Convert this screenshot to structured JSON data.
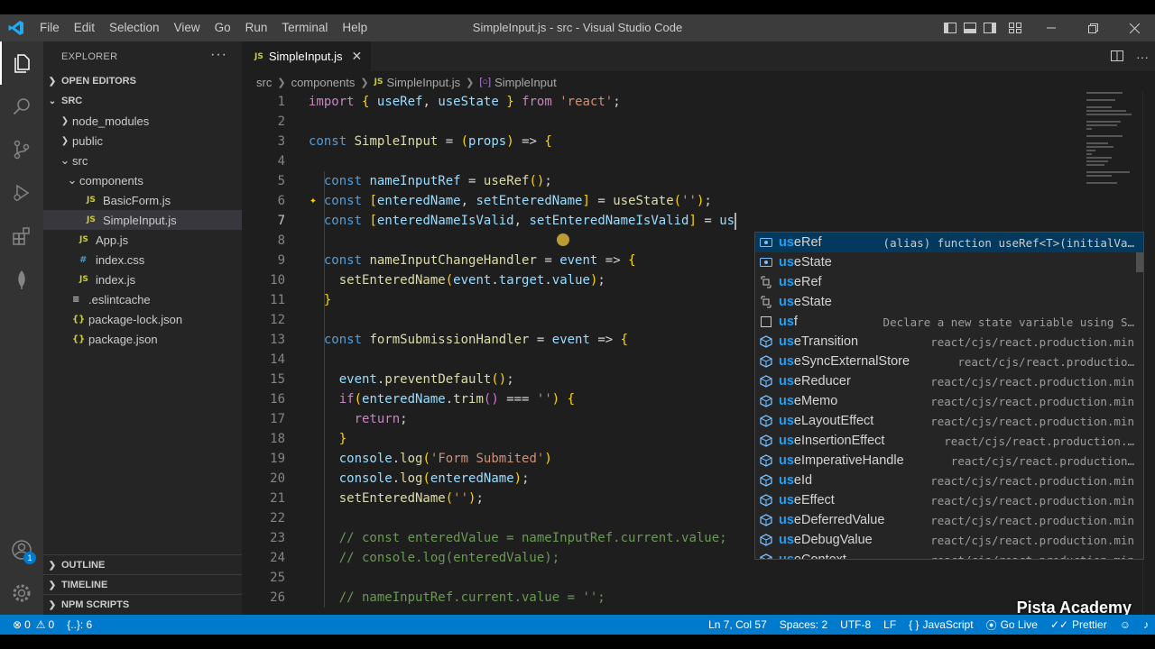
{
  "window": {
    "title": "SimpleInput.js - src - Visual Studio Code",
    "menu": [
      "File",
      "Edit",
      "Selection",
      "View",
      "Go",
      "Run",
      "Terminal",
      "Help"
    ]
  },
  "sidebar": {
    "header": "EXPLORER",
    "open_editors": "OPEN EDITORS",
    "root": "SRC",
    "tree": [
      {
        "label": "node_modules",
        "type": "folder",
        "depth": 1,
        "expanded": false
      },
      {
        "label": "public",
        "type": "folder",
        "depth": 1,
        "expanded": false
      },
      {
        "label": "src",
        "type": "folder",
        "depth": 1,
        "expanded": true
      },
      {
        "label": "components",
        "type": "folder",
        "depth": 2,
        "expanded": true
      },
      {
        "label": "BasicForm.js",
        "type": "js",
        "depth": 3
      },
      {
        "label": "SimpleInput.js",
        "type": "js",
        "depth": 3,
        "selected": true
      },
      {
        "label": "App.js",
        "type": "js",
        "depth": 2
      },
      {
        "label": "index.css",
        "type": "css",
        "depth": 2
      },
      {
        "label": "index.js",
        "type": "js",
        "depth": 2
      },
      {
        "label": ".eslintcache",
        "type": "lines",
        "depth": 1
      },
      {
        "label": "package-lock.json",
        "type": "json",
        "depth": 1
      },
      {
        "label": "package.json",
        "type": "json",
        "depth": 1
      }
    ],
    "outline": "OUTLINE",
    "timeline": "TIMELINE",
    "npm_scripts": "NPM SCRIPTS",
    "accounts_badge": "1"
  },
  "tab": {
    "label": "SimpleInput.js",
    "icon": "JS"
  },
  "breadcrumbs": [
    "src",
    "components",
    "SimpleInput.js",
    "SimpleInput"
  ],
  "code_lines": [
    {
      "n": "1",
      "text": "import { useRef, useState } from 'react';"
    },
    {
      "n": "2",
      "text": ""
    },
    {
      "n": "3",
      "text": "const SimpleInput = (props) => {"
    },
    {
      "n": "4",
      "text": ""
    },
    {
      "n": "5",
      "text": "  const nameInputRef = useRef();"
    },
    {
      "n": "6",
      "text": "  const [enteredName, setEnteredName] = useState('');"
    },
    {
      "n": "7",
      "text": "  const [enteredNameIsValid, setEnteredNameIsValid] = us"
    },
    {
      "n": "8",
      "text": ""
    },
    {
      "n": "9",
      "text": "  const nameInputChangeHandler = event => {"
    },
    {
      "n": "10",
      "text": "    setEnteredName(event.target.value);"
    },
    {
      "n": "11",
      "text": "  }"
    },
    {
      "n": "12",
      "text": ""
    },
    {
      "n": "13",
      "text": "  const formSubmissionHandler = event => {"
    },
    {
      "n": "14",
      "text": ""
    },
    {
      "n": "15",
      "text": "    event.preventDefault();"
    },
    {
      "n": "16",
      "text": "    if(enteredName.trim() === '') {"
    },
    {
      "n": "17",
      "text": "      return;"
    },
    {
      "n": "18",
      "text": "    }"
    },
    {
      "n": "19",
      "text": "    console.log('Form Submited')"
    },
    {
      "n": "20",
      "text": "    console.log(enteredName);"
    },
    {
      "n": "21",
      "text": "    setEnteredName('');"
    },
    {
      "n": "22",
      "text": ""
    },
    {
      "n": "23",
      "text": "    // const enteredValue = nameInputRef.current.value;"
    },
    {
      "n": "24",
      "text": "    // console.log(enteredValue);"
    },
    {
      "n": "25",
      "text": ""
    },
    {
      "n": "26",
      "text": "    // nameInputRef.current.value = '';"
    }
  ],
  "suggestions": [
    {
      "match": "us",
      "rest": "eRef",
      "kind": "variable",
      "detail": "(alias) function useRef<T>(initialVa…",
      "selected": true
    },
    {
      "match": "us",
      "rest": "eState",
      "kind": "variable",
      "detail": ""
    },
    {
      "match": "us",
      "rest": "eRef",
      "kind": "snippet",
      "detail": ""
    },
    {
      "match": "us",
      "rest": "eState",
      "kind": "snippet",
      "detail": ""
    },
    {
      "match": "us",
      "rest": "f",
      "kind": "text",
      "detail": "Declare a new state variable using S…"
    },
    {
      "match": "us",
      "rest": "eTransition",
      "kind": "module",
      "detail": "react/cjs/react.production.min"
    },
    {
      "match": "us",
      "rest": "eSyncExternalStore",
      "kind": "module",
      "detail": "react/cjs/react.productio…"
    },
    {
      "match": "us",
      "rest": "eReducer",
      "kind": "module",
      "detail": "react/cjs/react.production.min"
    },
    {
      "match": "us",
      "rest": "eMemo",
      "kind": "module",
      "detail": "react/cjs/react.production.min"
    },
    {
      "match": "us",
      "rest": "eLayoutEffect",
      "kind": "module",
      "detail": "react/cjs/react.production.min"
    },
    {
      "match": "us",
      "rest": "eInsertionEffect",
      "kind": "module",
      "detail": "react/cjs/react.production.…"
    },
    {
      "match": "us",
      "rest": "eImperativeHandle",
      "kind": "module",
      "detail": "react/cjs/react.production…"
    },
    {
      "match": "us",
      "rest": "eId",
      "kind": "module",
      "detail": "react/cjs/react.production.min"
    },
    {
      "match": "us",
      "rest": "eEffect",
      "kind": "module",
      "detail": "react/cjs/react.production.min"
    },
    {
      "match": "us",
      "rest": "eDeferredValue",
      "kind": "module",
      "detail": "react/cjs/react.production.min"
    },
    {
      "match": "us",
      "rest": "eDebugValue",
      "kind": "module",
      "detail": "react/cjs/react.production.min"
    },
    {
      "match": "us",
      "rest": "eContext",
      "kind": "module",
      "detail": "react/cjs/react.production.min"
    }
  ],
  "status": {
    "errors": "0",
    "warnings": "0",
    "braces": "{..}: 6",
    "position": "Ln 7, Col 57",
    "spaces": "Spaces: 2",
    "encoding": "UTF-8",
    "eol": "LF",
    "language": "JavaScript",
    "golive": "Go Live",
    "prettier": "Prettier"
  },
  "watermark": "Pista Academy",
  "colors": {
    "accent": "#007acc",
    "sidebar": "#252526",
    "editor": "#1e1e1e",
    "activitybar": "#333333"
  }
}
